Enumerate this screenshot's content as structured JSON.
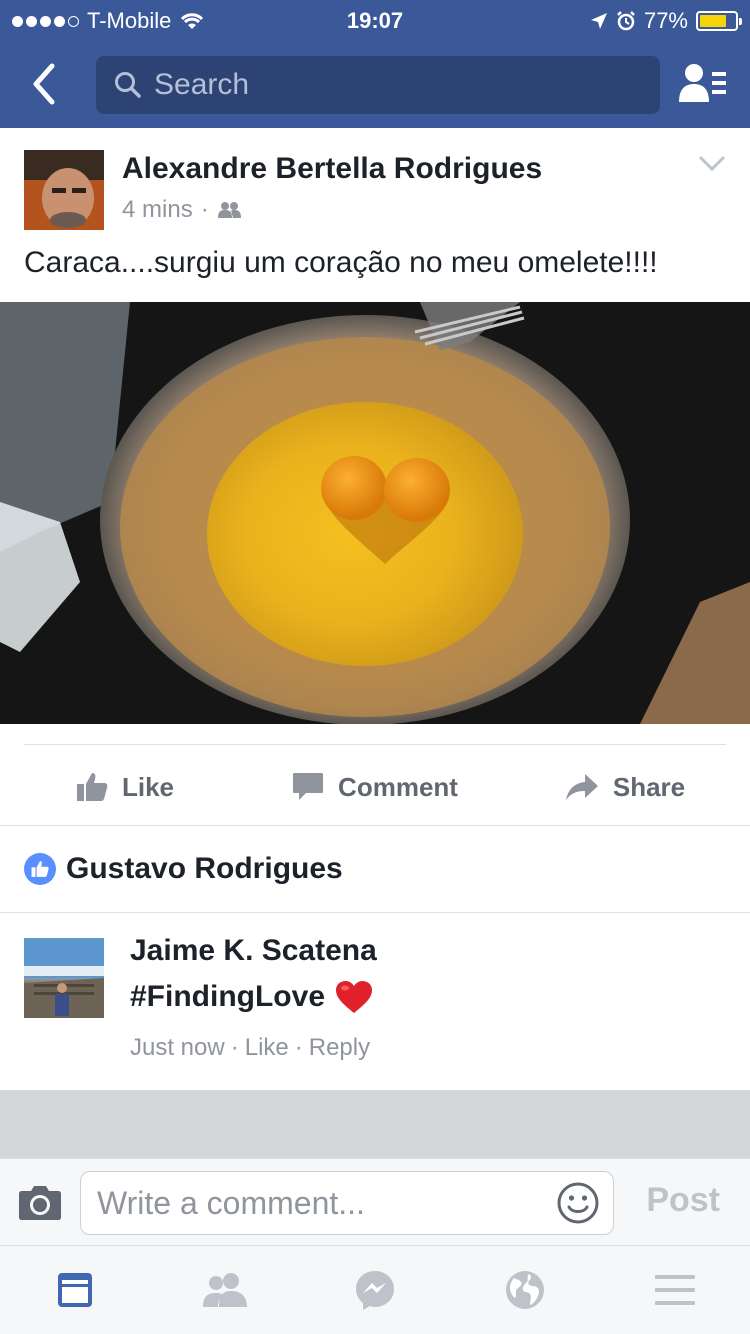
{
  "status_bar": {
    "carrier": "T-Mobile",
    "time": "19:07",
    "battery_percent": "77%",
    "battery_level": 0.77,
    "signal_dots_filled": 4,
    "signal_dots_total": 5
  },
  "navbar": {
    "search_placeholder": "Search",
    "back_icon": "chevron-left-icon",
    "friends_icon": "friend-requests-icon"
  },
  "post": {
    "author": "Alexandre Bertella Rodrigues",
    "time": "4 mins",
    "separator": "·",
    "audience_icon": "friends-audience-icon",
    "text": "Caraca....surgiu um coração no meu omelete!!!!"
  },
  "actions": {
    "like": "Like",
    "comment": "Comment",
    "share": "Share"
  },
  "likes": {
    "liker": "Gustavo Rodrigues"
  },
  "comment": {
    "author": "Jaime K. Scatena",
    "text": "#FindingLove",
    "emoji": "❤️",
    "time": "Just now",
    "like": "Like",
    "reply": "Reply",
    "sep": "·"
  },
  "composer": {
    "placeholder": "Write a comment...",
    "post_label": "Post"
  },
  "colors": {
    "brand": "#3b5998",
    "active_tab": "#4267b2",
    "inactive_tab": "#bec3c9"
  }
}
